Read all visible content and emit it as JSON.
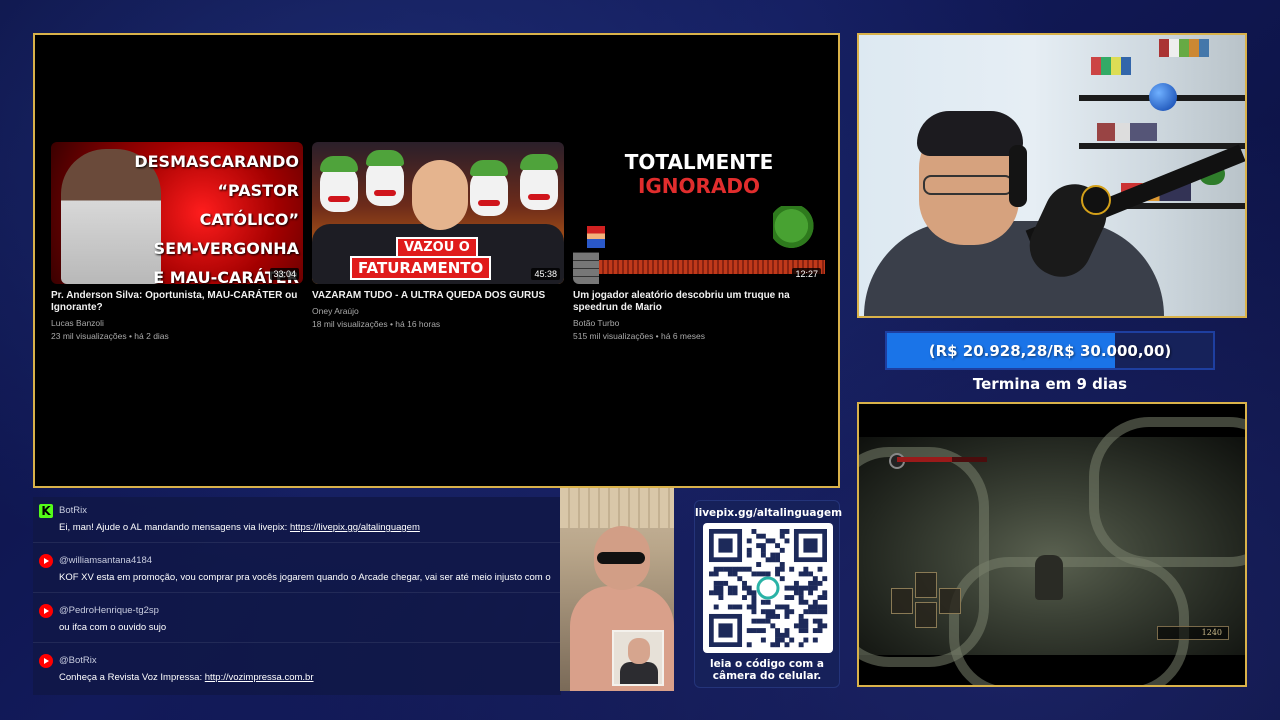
{
  "videos": [
    {
      "thumb_lines": [
        "DESMASCARANDO",
        "“PASTOR CATÓLICO”",
        "SEM-VERGONHA",
        "E MAU-CARÁTER"
      ],
      "duration": "33:04",
      "title": "Pr. Anderson Silva: Oportunista, MAU-CARÁTER ou Ignorante?",
      "channel": "Lucas Banzoli",
      "meta": "23 mil visualizações • há 2 dias"
    },
    {
      "thumb_badge_1": "VAZOU O",
      "thumb_badge_2": "FATURAMENTO",
      "duration": "45:38",
      "title": "VAZARAM TUDO - A ULTRA QUEDA DOS GURUS",
      "channel": "Oney Araújo",
      "meta": "18 mil visualizações • há 16 horas"
    },
    {
      "thumb_line_1": "TOTALMENTE",
      "thumb_line_2": "IGNORADO",
      "duration": "12:27",
      "title": "Um jogador aleatório descobriu um truque na speedrun de Mario",
      "channel": "Botão Turbo",
      "meta": "515 mil visualizações • há 6 meses"
    }
  ],
  "goal": {
    "text": "(R$ 20.928,28/R$ 30.000,00)",
    "progress_fraction": 0.698,
    "subtitle": "Termina em 9 dias"
  },
  "game": {
    "souls": "1240"
  },
  "chat": [
    {
      "platform": "kick",
      "icon": "kick-icon",
      "user": "BotRix",
      "text": "Ei, man! Ajude o AL mandando mensagens via livepix: ",
      "link": "https://livepix.gg/altalinguagem"
    },
    {
      "platform": "youtube",
      "icon": "youtube-icon",
      "user": "@williamsantana4184",
      "text": "KOF XV esta em promoção, vou comprar pra vocês jogarem quando o Arcade chegar, vai ser até meio injusto com o",
      "link": ""
    },
    {
      "platform": "youtube",
      "icon": "youtube-icon",
      "user": "@PedroHenrique-tg2sp",
      "text": "ou ifca com o ouvido sujo",
      "link": ""
    },
    {
      "platform": "youtube",
      "icon": "youtube-icon",
      "user": "@BotRix",
      "text": "Conheça a Revista Voz Impressa: ",
      "link": "http://vozimpressa.com.br"
    }
  ],
  "livepix": {
    "url": "livepix.gg/altalinguagem",
    "caption": "leia o código com a\ncâmera do celular."
  },
  "colors": {
    "frame_gold": "#d9b24a",
    "goal_fill": "#1a74e8",
    "kick_green": "#53fc18",
    "youtube_red": "#ff0000"
  }
}
